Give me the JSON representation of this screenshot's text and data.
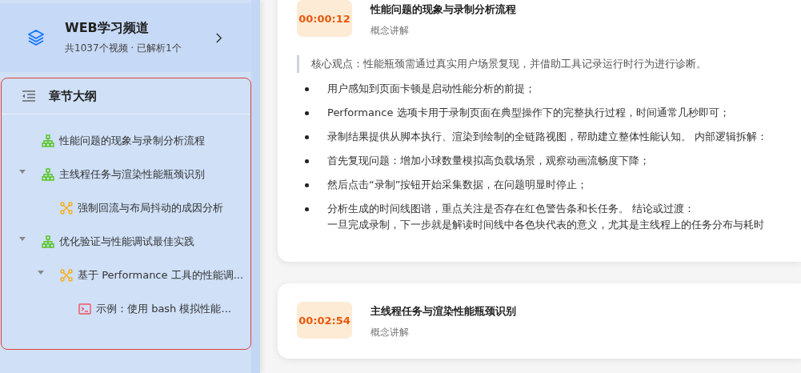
{
  "channel": {
    "title": "WEB学习频道",
    "subtitle": "共1037个视频 · 已解析1个"
  },
  "outline": {
    "title": "章节大纲",
    "items": [
      {
        "kind": "chapter",
        "label": "性能问题的现象与录制分析流程"
      },
      {
        "kind": "chapter",
        "label": "主线程任务与渲染性能瓶颈识别",
        "expanded": true,
        "children": [
          {
            "kind": "section",
            "label": "强制回流与布局抖动的成因分析"
          }
        ]
      },
      {
        "kind": "chapter",
        "label": "优化验证与性能调试最佳实践",
        "expanded": true,
        "children": [
          {
            "kind": "section",
            "label": "基于 Performance 工具的性能调...",
            "expanded": true,
            "children": [
              {
                "kind": "example",
                "label": "示例：使用 bash 模拟性能..."
              }
            ]
          }
        ]
      }
    ]
  },
  "cards": [
    {
      "time": "00:00:12",
      "title": "性能问题的现象与录制分析流程",
      "tag": "概念讲解",
      "quote": "核心观点：性能瓶颈需通过真实用户场景复现，并借助工具记录运行时行为进行诊断。",
      "bullets": [
        {
          "lines": [
            "用户感知到页面卡顿是启动性能分析的前提；"
          ]
        },
        {
          "lines": [
            "Performance 选项卡用于录制页面在典型操作下的完整执行过程，时间通常几秒即可；"
          ]
        },
        {
          "lines": [
            "录制结果提供从脚本执行、渲染到绘制的全链路视图，帮助建立整体性能认知。 内部逻辑拆解："
          ]
        },
        {
          "lines": [
            "首先复现问题：增加小球数量模拟高负载场景，观察动画流畅度下降；"
          ]
        },
        {
          "lines": [
            "然后点击“录制”按钮开始采集数据，在问题明显时停止；"
          ]
        },
        {
          "lines": [
            "分析生成的时间线图谱，重点关注是否存在红色警告条和长任务。 结论或过渡：",
            "一旦完成录制，下一步就是解读时间线中各色块代表的意义，尤其是主线程上的任务分布与耗时"
          ]
        }
      ]
    },
    {
      "time": "00:02:54",
      "title": "主线程任务与渲染性能瓶颈识别",
      "tag": "概念讲解"
    }
  ]
}
